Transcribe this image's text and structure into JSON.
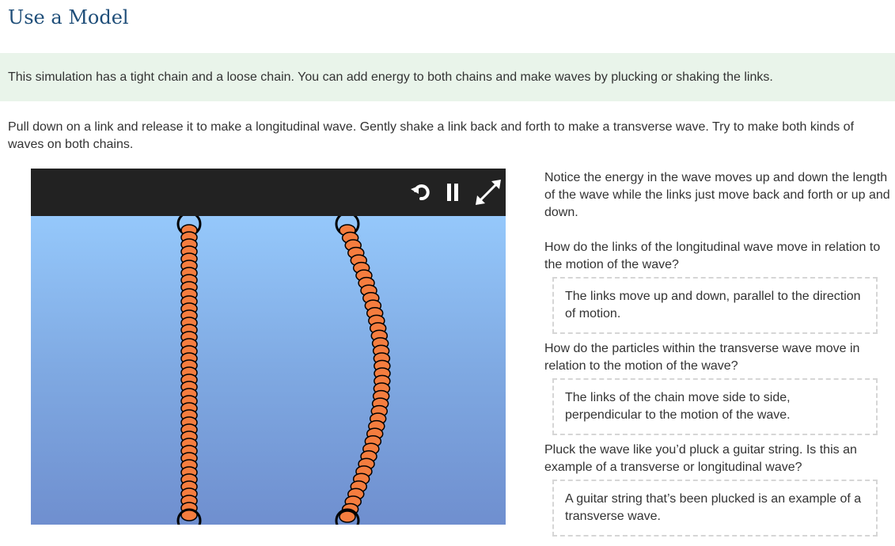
{
  "page": {
    "title": "Use a Model"
  },
  "intro": {
    "text": "This simulation has a tight chain and a loose chain. You can add energy to both chains and make waves by plucking or shaking the links."
  },
  "instructions": {
    "text": "Pull down on a link and release it to make a longitudinal wave. Gently shake a link back and forth to make a transverse wave. Try to make both kinds of waves on both chains."
  },
  "simulation": {
    "toolbar": {
      "buttons": [
        {
          "name": "reset",
          "icon": "reset-icon"
        },
        {
          "name": "pause",
          "icon": "pause-icon"
        },
        {
          "name": "fullscreen",
          "icon": "fullscreen-icon"
        }
      ]
    },
    "colors": {
      "toolbar": "#222222",
      "sky_top": "#95c8fb",
      "sky_bottom": "#6f8fcf",
      "link_fill": "#f57d3f",
      "link_outline": "#000000"
    }
  },
  "notes": {
    "notice": "Notice the energy in the wave moves up and down the length of the wave while the links just move back and forth or up and down.",
    "questions": [
      {
        "prompt": "How do the links of the longitudinal wave move in relation to the motion of the wave?",
        "answer": "The links move up and down, parallel to the direction of motion."
      },
      {
        "prompt": "How do the particles within the transverse wave move in relation to the motion of the wave?",
        "answer": "The links of the chain move side to side, perpendicular to the motion of the wave."
      },
      {
        "prompt": "Pluck the wave like you’d pluck a guitar string. Is this an example of a transverse or longitudinal wave?",
        "answer": "A guitar string that’s been plucked is an example of a transverse wave."
      }
    ]
  }
}
